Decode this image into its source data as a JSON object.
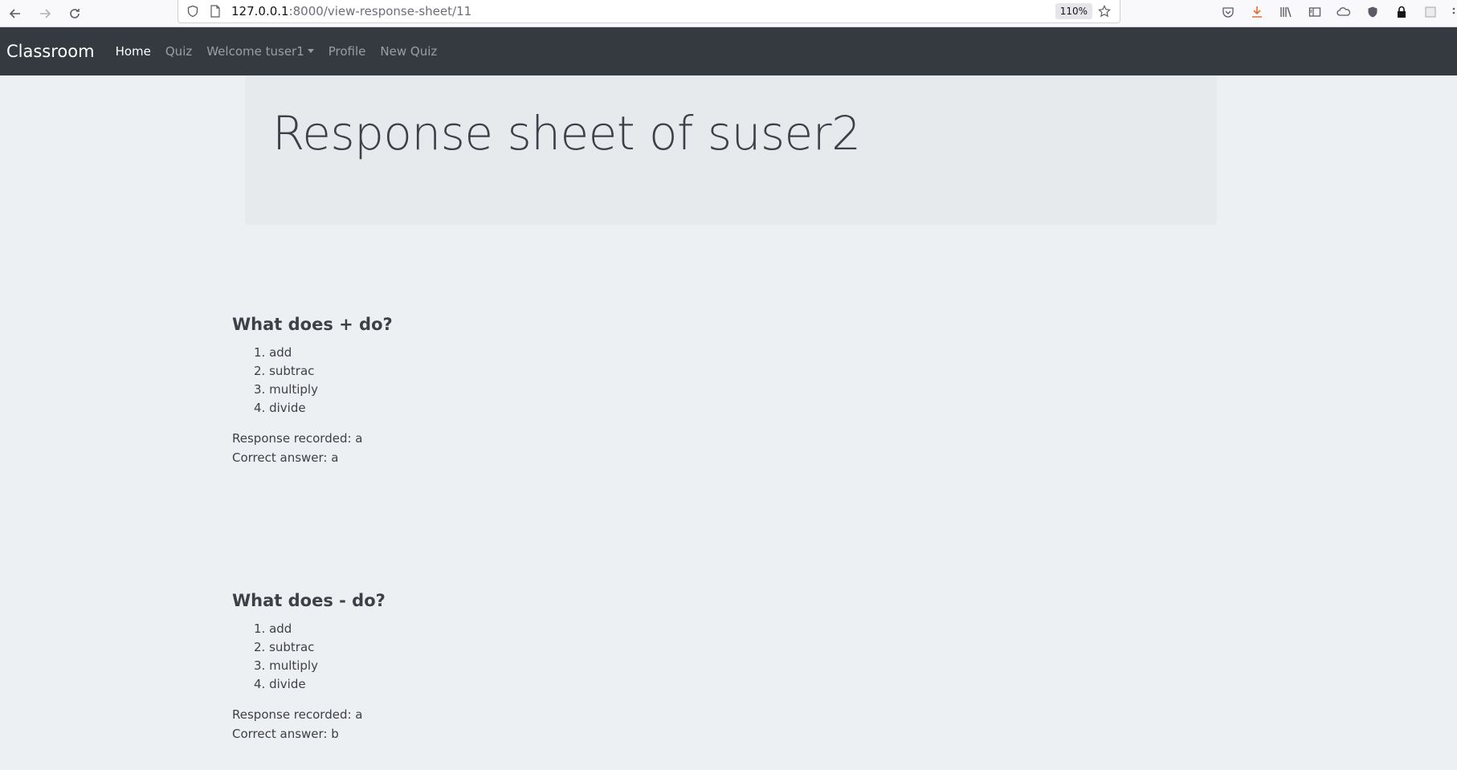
{
  "browser": {
    "url_host": "127.0.0.1",
    "url_path": ":8000/view-response-sheet/11",
    "zoom": "110%"
  },
  "navbar": {
    "brand": "Classroom",
    "links": [
      {
        "label": "Home",
        "active": true
      },
      {
        "label": "Quiz"
      },
      {
        "label": "Welcome tuser1",
        "dropdown": true
      },
      {
        "label": "Profile"
      },
      {
        "label": "New Quiz"
      }
    ]
  },
  "page": {
    "title": "Response sheet of suser2"
  },
  "questions": [
    {
      "title": "What does + do?",
      "options": [
        "1. add",
        "2. subtrac",
        "3. multiply",
        "4. divide"
      ],
      "response": "Response recorded: a",
      "correct": "Correct answer: a"
    },
    {
      "title": "What does - do?",
      "options": [
        "1. add",
        "2. subtrac",
        "3. multiply",
        "4. divide"
      ],
      "response": "Response recorded: a",
      "correct": "Correct answer: b"
    }
  ]
}
